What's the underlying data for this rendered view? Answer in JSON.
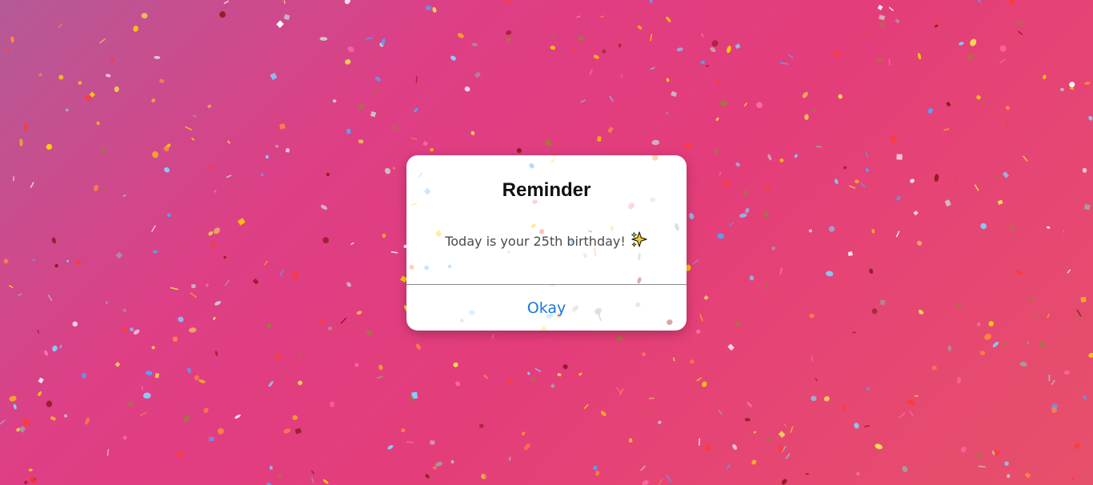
{
  "dialog": {
    "title": "Reminder",
    "message": "Today is your 25th birthday!",
    "message_icon": "sparkles-icon",
    "okay_label": "Okay"
  },
  "colors": {
    "background_start": "#b55a97",
    "background_mid": "#e43d7b",
    "background_end": "#e7506a",
    "button_text": "#1a78e0",
    "title_text": "#111111",
    "message_text": "#4a4a4a",
    "sparkle": "#f5d020"
  }
}
